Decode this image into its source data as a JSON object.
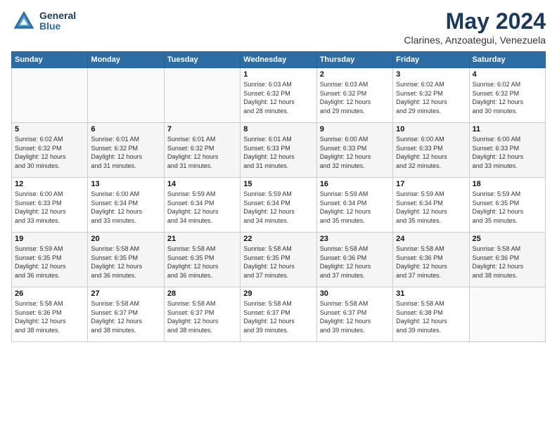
{
  "header": {
    "logo_general": "General",
    "logo_blue": "Blue",
    "month": "May 2024",
    "location": "Clarines, Anzoategui, Venezuela"
  },
  "weekdays": [
    "Sunday",
    "Monday",
    "Tuesday",
    "Wednesday",
    "Thursday",
    "Friday",
    "Saturday"
  ],
  "weeks": [
    [
      {
        "day": "",
        "info": ""
      },
      {
        "day": "",
        "info": ""
      },
      {
        "day": "",
        "info": ""
      },
      {
        "day": "1",
        "info": "Sunrise: 6:03 AM\nSunset: 6:32 PM\nDaylight: 12 hours\nand 28 minutes."
      },
      {
        "day": "2",
        "info": "Sunrise: 6:03 AM\nSunset: 6:32 PM\nDaylight: 12 hours\nand 29 minutes."
      },
      {
        "day": "3",
        "info": "Sunrise: 6:02 AM\nSunset: 6:32 PM\nDaylight: 12 hours\nand 29 minutes."
      },
      {
        "day": "4",
        "info": "Sunrise: 6:02 AM\nSunset: 6:32 PM\nDaylight: 12 hours\nand 30 minutes."
      }
    ],
    [
      {
        "day": "5",
        "info": "Sunrise: 6:02 AM\nSunset: 6:32 PM\nDaylight: 12 hours\nand 30 minutes."
      },
      {
        "day": "6",
        "info": "Sunrise: 6:01 AM\nSunset: 6:32 PM\nDaylight: 12 hours\nand 31 minutes."
      },
      {
        "day": "7",
        "info": "Sunrise: 6:01 AM\nSunset: 6:32 PM\nDaylight: 12 hours\nand 31 minutes."
      },
      {
        "day": "8",
        "info": "Sunrise: 6:01 AM\nSunset: 6:33 PM\nDaylight: 12 hours\nand 31 minutes."
      },
      {
        "day": "9",
        "info": "Sunrise: 6:00 AM\nSunset: 6:33 PM\nDaylight: 12 hours\nand 32 minutes."
      },
      {
        "day": "10",
        "info": "Sunrise: 6:00 AM\nSunset: 6:33 PM\nDaylight: 12 hours\nand 32 minutes."
      },
      {
        "day": "11",
        "info": "Sunrise: 6:00 AM\nSunset: 6:33 PM\nDaylight: 12 hours\nand 33 minutes."
      }
    ],
    [
      {
        "day": "12",
        "info": "Sunrise: 6:00 AM\nSunset: 6:33 PM\nDaylight: 12 hours\nand 33 minutes."
      },
      {
        "day": "13",
        "info": "Sunrise: 6:00 AM\nSunset: 6:34 PM\nDaylight: 12 hours\nand 33 minutes."
      },
      {
        "day": "14",
        "info": "Sunrise: 5:59 AM\nSunset: 6:34 PM\nDaylight: 12 hours\nand 34 minutes."
      },
      {
        "day": "15",
        "info": "Sunrise: 5:59 AM\nSunset: 6:34 PM\nDaylight: 12 hours\nand 34 minutes."
      },
      {
        "day": "16",
        "info": "Sunrise: 5:59 AM\nSunset: 6:34 PM\nDaylight: 12 hours\nand 35 minutes."
      },
      {
        "day": "17",
        "info": "Sunrise: 5:59 AM\nSunset: 6:34 PM\nDaylight: 12 hours\nand 35 minutes."
      },
      {
        "day": "18",
        "info": "Sunrise: 5:59 AM\nSunset: 6:35 PM\nDaylight: 12 hours\nand 35 minutes."
      }
    ],
    [
      {
        "day": "19",
        "info": "Sunrise: 5:59 AM\nSunset: 6:35 PM\nDaylight: 12 hours\nand 36 minutes."
      },
      {
        "day": "20",
        "info": "Sunrise: 5:58 AM\nSunset: 6:35 PM\nDaylight: 12 hours\nand 36 minutes."
      },
      {
        "day": "21",
        "info": "Sunrise: 5:58 AM\nSunset: 6:35 PM\nDaylight: 12 hours\nand 36 minutes."
      },
      {
        "day": "22",
        "info": "Sunrise: 5:58 AM\nSunset: 6:35 PM\nDaylight: 12 hours\nand 37 minutes."
      },
      {
        "day": "23",
        "info": "Sunrise: 5:58 AM\nSunset: 6:36 PM\nDaylight: 12 hours\nand 37 minutes."
      },
      {
        "day": "24",
        "info": "Sunrise: 5:58 AM\nSunset: 6:36 PM\nDaylight: 12 hours\nand 37 minutes."
      },
      {
        "day": "25",
        "info": "Sunrise: 5:58 AM\nSunset: 6:36 PM\nDaylight: 12 hours\nand 38 minutes."
      }
    ],
    [
      {
        "day": "26",
        "info": "Sunrise: 5:58 AM\nSunset: 6:36 PM\nDaylight: 12 hours\nand 38 minutes."
      },
      {
        "day": "27",
        "info": "Sunrise: 5:58 AM\nSunset: 6:37 PM\nDaylight: 12 hours\nand 38 minutes."
      },
      {
        "day": "28",
        "info": "Sunrise: 5:58 AM\nSunset: 6:37 PM\nDaylight: 12 hours\nand 38 minutes."
      },
      {
        "day": "29",
        "info": "Sunrise: 5:58 AM\nSunset: 6:37 PM\nDaylight: 12 hours\nand 39 minutes."
      },
      {
        "day": "30",
        "info": "Sunrise: 5:58 AM\nSunset: 6:37 PM\nDaylight: 12 hours\nand 39 minutes."
      },
      {
        "day": "31",
        "info": "Sunrise: 5:58 AM\nSunset: 6:38 PM\nDaylight: 12 hours\nand 39 minutes."
      },
      {
        "day": "",
        "info": ""
      }
    ]
  ]
}
